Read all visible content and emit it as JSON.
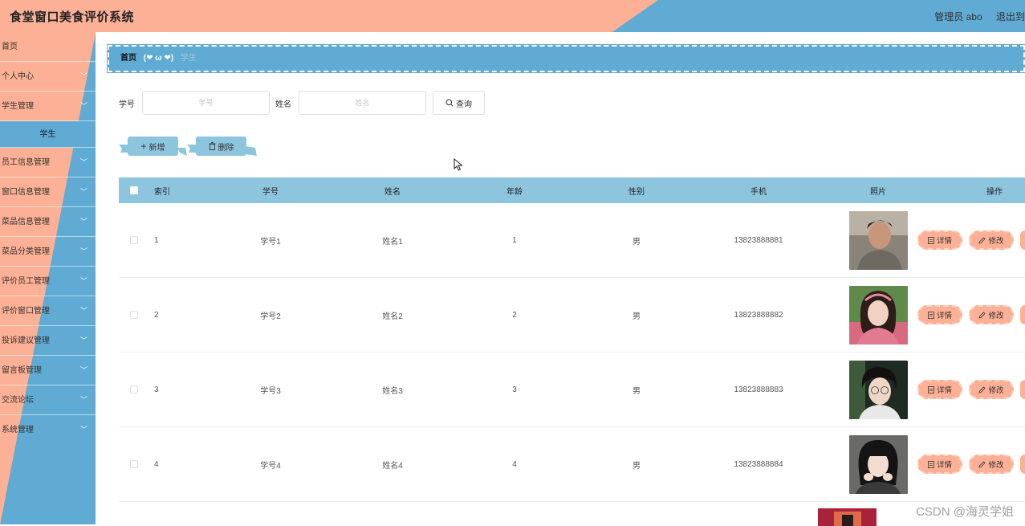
{
  "header": {
    "title": "食堂窗口美食评价系统",
    "user_label": "管理员 abo",
    "logout_label": "退出到前"
  },
  "sidebar": {
    "items": [
      {
        "label": "首页",
        "has_chevron": false
      },
      {
        "label": "个人中心",
        "has_chevron": true
      },
      {
        "label": "学生管理",
        "has_chevron": true
      },
      {
        "label": "员工信息管理",
        "has_chevron": true
      },
      {
        "label": "窗口信息管理",
        "has_chevron": true
      },
      {
        "label": "菜品信息管理",
        "has_chevron": true
      },
      {
        "label": "菜品分类管理",
        "has_chevron": true
      },
      {
        "label": "评价员工管理",
        "has_chevron": true
      },
      {
        "label": "评价窗口管理",
        "has_chevron": true
      },
      {
        "label": "投诉建议管理",
        "has_chevron": true
      },
      {
        "label": "留言板管理",
        "has_chevron": true
      },
      {
        "label": "交流论坛",
        "has_chevron": true
      },
      {
        "label": "系统管理",
        "has_chevron": true
      }
    ],
    "active_sub": "学生"
  },
  "breadcrumb": {
    "home": "首页",
    "separator": "(❤ ω ❤)",
    "current": "学生"
  },
  "search": {
    "num_label": "学号",
    "num_placeholder": "学号",
    "name_label": "姓名",
    "name_placeholder": "姓名",
    "query_label": "查询"
  },
  "actions": {
    "add_label": "新增",
    "delete_label": "删除"
  },
  "table": {
    "headers": {
      "index": "索引",
      "num": "学号",
      "name": "姓名",
      "age": "年龄",
      "sex": "性别",
      "phone": "手机",
      "photo": "照片",
      "op": "操作"
    },
    "rows": [
      {
        "index": "1",
        "num": "学号1",
        "name": "姓名1",
        "age": "1",
        "sex": "男",
        "phone": "13823888881"
      },
      {
        "index": "2",
        "num": "学号2",
        "name": "姓名2",
        "age": "2",
        "sex": "男",
        "phone": "13823888882"
      },
      {
        "index": "3",
        "num": "学号3",
        "name": "姓名3",
        "age": "3",
        "sex": "男",
        "phone": "13823888883"
      },
      {
        "index": "4",
        "num": "学号4",
        "name": "姓名4",
        "age": "4",
        "sex": "男",
        "phone": "13823888884"
      }
    ],
    "detail_label": "详情",
    "edit_label": "修改"
  },
  "watermark": "CSDN @海灵学姐",
  "colors": {
    "accent_peach": "#fcb095",
    "accent_blue": "#5fabd3",
    "table_header": "#8dc5de"
  }
}
